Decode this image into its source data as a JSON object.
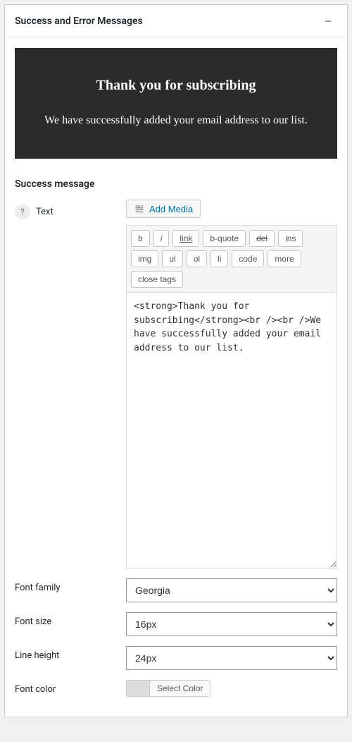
{
  "panel": {
    "title": "Success and Error Messages"
  },
  "preview": {
    "title": "Thank you for subscribing",
    "subtitle": "We have successfully added your email address to our list."
  },
  "section_heading": "Success message",
  "text_row": {
    "label": "Text",
    "add_media": "Add Media"
  },
  "toolbar": {
    "b": "b",
    "i": "i",
    "link": "link",
    "bquote": "b-quote",
    "del": "del",
    "ins": "ins",
    "img": "img",
    "ul": "ul",
    "ol": "ol",
    "li": "li",
    "code": "code",
    "more": "more",
    "close": "close tags"
  },
  "editor_value": "<strong>Thank you for subscribing</strong><br /><br />We have successfully added your email address to our list.",
  "font_family": {
    "label": "Font family",
    "value": "Georgia"
  },
  "font_size": {
    "label": "Font size",
    "value": "16px"
  },
  "line_height": {
    "label": "Line height",
    "value": "24px"
  },
  "font_color": {
    "label": "Font color",
    "button": "Select Color"
  }
}
